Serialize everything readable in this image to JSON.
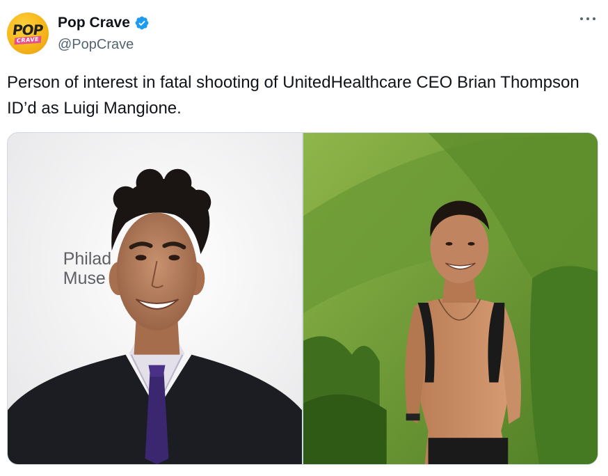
{
  "tweet": {
    "author": {
      "display_name": "Pop Crave",
      "handle": "@PopCrave",
      "verified": true,
      "avatar_text_top": "POP",
      "avatar_text_bottom": "CRAVE"
    },
    "text": "Person of interest in fatal shooting of UnitedHealthcare CEO Brian Thompson ID’d as Luigi Mangione.",
    "media": {
      "left_photo": {
        "backdrop_text_line1": "Philad",
        "backdrop_text_line2": "Muse"
      },
      "right_photo": {}
    }
  },
  "colors": {
    "verified_blue": "#1d9bf0",
    "text_primary": "#0f1419",
    "text_secondary": "#536471"
  },
  "icons": {
    "verified": "verified-badge-icon",
    "more": "more-options-icon"
  }
}
